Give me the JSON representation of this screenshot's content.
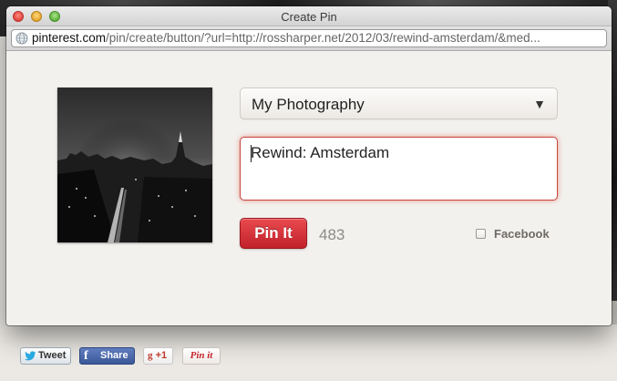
{
  "window": {
    "title": "Create Pin"
  },
  "address_bar": {
    "host": "pinterest.com",
    "path": "/pin/create/button/?url=http://rossharper.net/2012/03/rewind-amsterdam/&med..."
  },
  "form": {
    "board": {
      "selected": "My Photography"
    },
    "description": {
      "value": "Rewind: Amsterdam"
    },
    "pin_button_label": "Pin It",
    "char_count": "483",
    "facebook": {
      "label": "Facebook",
      "checked": false
    }
  },
  "share_bar": {
    "tweet_label": "Tweet",
    "share_label": "Share",
    "gplus_label": "+1",
    "pinit_label": "Pin it"
  },
  "colors": {
    "pin_red": "#cb2027",
    "facebook_blue": "#3b5998",
    "focus_ring": "#c8453d"
  },
  "icons": {
    "globe": "globe-icon",
    "dropdown": "triangle-down-icon",
    "twitter": "twitter-bird-icon",
    "facebook": "facebook-f-icon",
    "gplus": "google-plus-icon"
  }
}
